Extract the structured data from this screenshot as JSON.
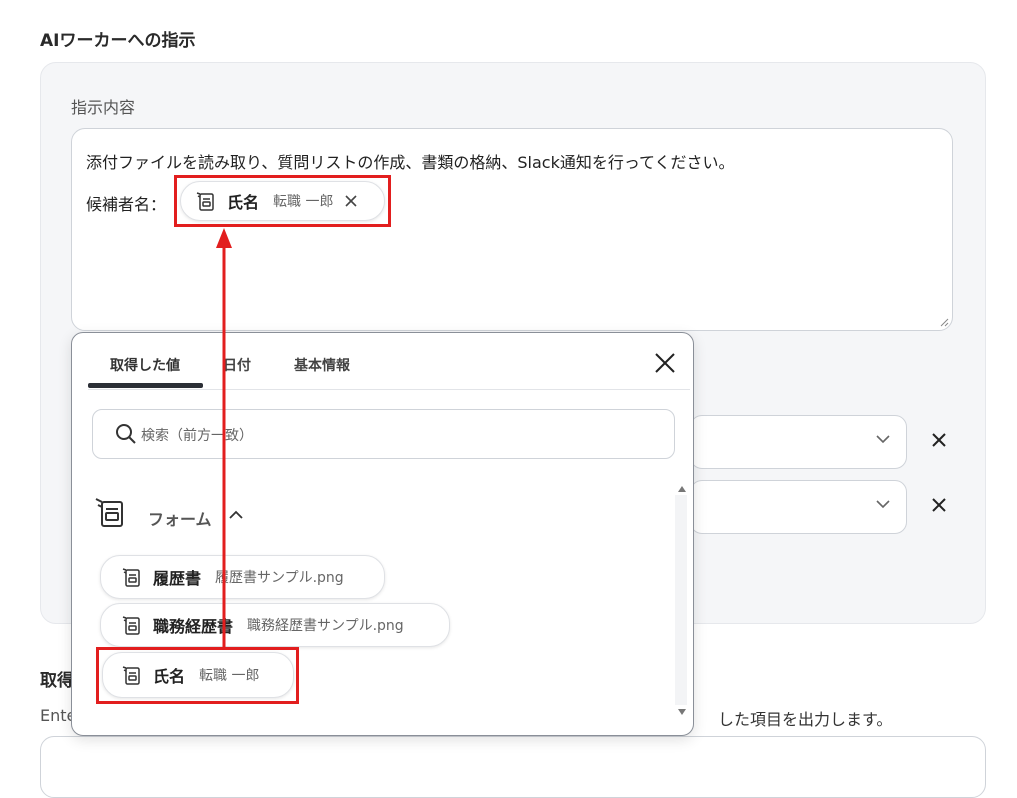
{
  "section_title": "AIワーカーへの指示",
  "instruction": {
    "label": "指示内容",
    "text": "添付ファイルを読み取り、質問リストの作成、書類の格納、Slack通知を行ってください。",
    "candidate_label": "候補者名：",
    "inserted_chip": {
      "main": "氏名",
      "sub": "転職 一郎"
    }
  },
  "popup": {
    "tabs": [
      {
        "label": "取得した値"
      },
      {
        "label": "日付"
      },
      {
        "label": "基本情報"
      }
    ],
    "search_placeholder": "検索（前方一致）",
    "group_label": "フォーム",
    "items": [
      {
        "main": "履歴書",
        "sub": "履歴書サンプル.png"
      },
      {
        "main": "職務経歴書",
        "sub": "職務経歴書サンプル.png"
      },
      {
        "main": "氏名",
        "sub": "転職 一郎"
      }
    ]
  },
  "lower": {
    "title_partial": "取得",
    "desc_partial": "Ente",
    "desc_tail": "した項目を出力します。"
  },
  "colors": {
    "highlight": "#e21e1e",
    "panel_bg": "#f5f6f8"
  },
  "icons": [
    "form-field-icon",
    "close-icon",
    "search-icon",
    "chevron-down-icon",
    "chevron-up-icon"
  ]
}
